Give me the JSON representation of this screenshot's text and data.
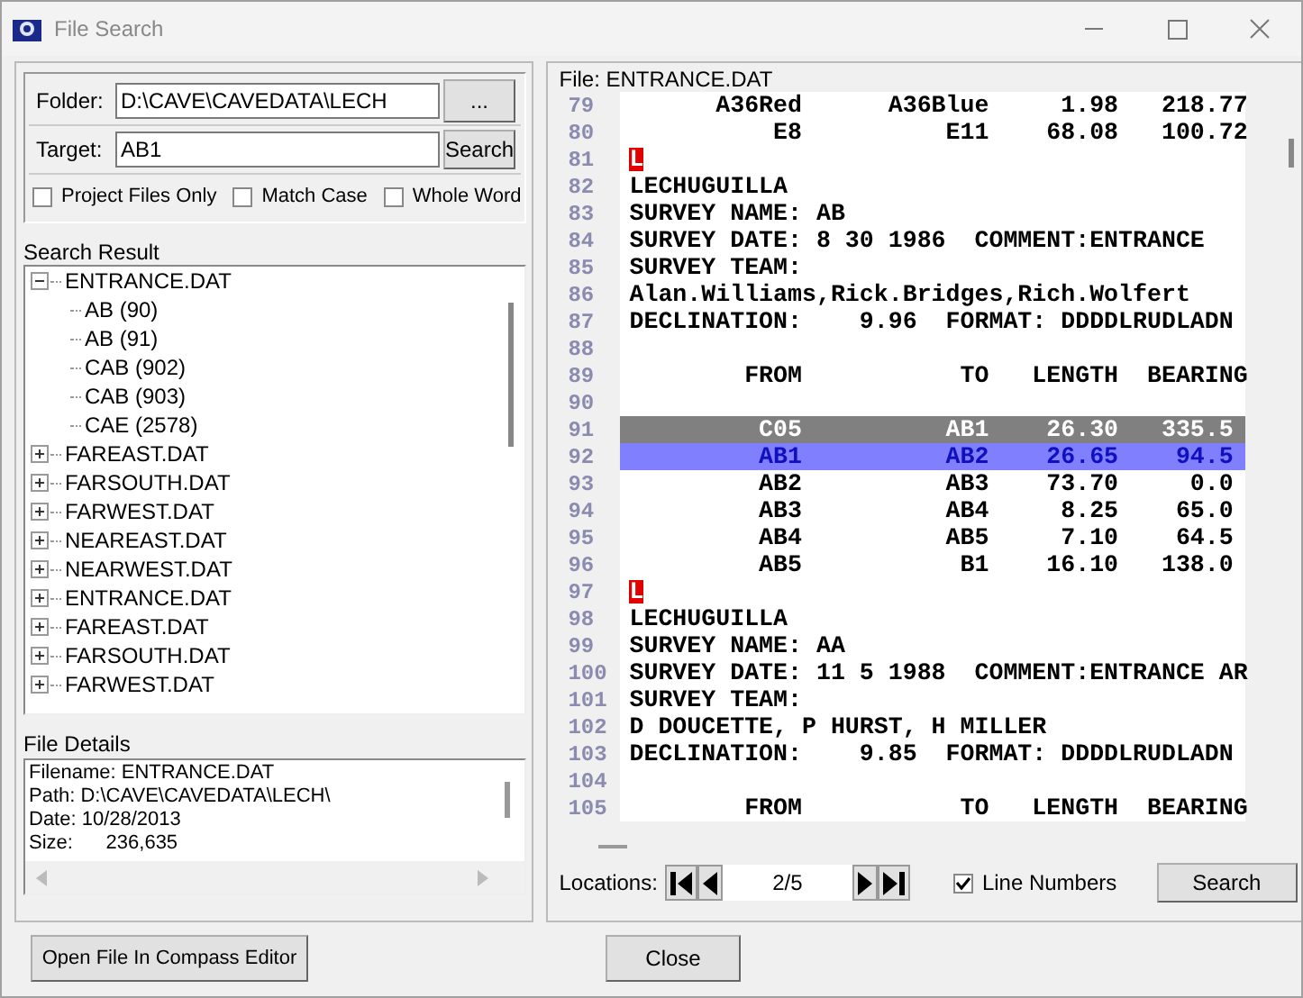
{
  "window": {
    "title": "File Search"
  },
  "search_form": {
    "folder_label": "Folder:",
    "folder_value": "D:\\CAVE\\CAVEDATA\\LECH",
    "browse_button": "...",
    "target_label": "Target:",
    "target_value": "AB1",
    "search_button": "Search",
    "options": [
      {
        "label": "Project Files Only",
        "checked": false
      },
      {
        "label": "Match Case",
        "checked": false
      },
      {
        "label": "Whole Word",
        "checked": false
      }
    ]
  },
  "search_result": {
    "label": "Search Result",
    "tree": [
      {
        "label": "ENTRANCE.DAT",
        "expanded": true,
        "children": [
          {
            "label": "AB (90)"
          },
          {
            "label": "AB (91)"
          },
          {
            "label": "CAB (902)"
          },
          {
            "label": "CAB (903)"
          },
          {
            "label": "CAE (2578)"
          }
        ]
      },
      {
        "label": "FAREAST.DAT",
        "expanded": false
      },
      {
        "label": "FARSOUTH.DAT",
        "expanded": false
      },
      {
        "label": "FARWEST.DAT",
        "expanded": false
      },
      {
        "label": "NEAREAST.DAT",
        "expanded": false
      },
      {
        "label": "NEARWEST.DAT",
        "expanded": false
      },
      {
        "label": "ENTRANCE.DAT",
        "expanded": false
      },
      {
        "label": "FAREAST.DAT",
        "expanded": false
      },
      {
        "label": "FARSOUTH.DAT",
        "expanded": false
      },
      {
        "label": "FARWEST.DAT",
        "expanded": false
      }
    ]
  },
  "file_details": {
    "label": "File Details",
    "lines": [
      "Filename: ENTRANCE.DAT",
      "Path: D:\\CAVE\\CAVEDATA\\LECH\\",
      "Date: 10/28/2013",
      "Size:      236,635"
    ]
  },
  "viewer": {
    "file_label": "File: ENTRANCE.DAT",
    "lines": [
      {
        "number": "79",
        "kind": "text",
        "text": "      A36Red      A36Blue     1.98   218.77"
      },
      {
        "number": "80",
        "kind": "text",
        "text": "          E8          E11    68.08   100.72"
      },
      {
        "number": "81",
        "kind": "marker",
        "text": "L"
      },
      {
        "number": "82",
        "kind": "text",
        "text": "LECHUGUILLA"
      },
      {
        "number": "83",
        "kind": "text",
        "text": "SURVEY NAME: AB"
      },
      {
        "number": "84",
        "kind": "text",
        "text": "SURVEY DATE: 8 30 1986  COMMENT:ENTRANCE"
      },
      {
        "number": "85",
        "kind": "text",
        "text": "SURVEY TEAM:"
      },
      {
        "number": "86",
        "kind": "text",
        "text": "Alan.Williams,Rick.Bridges,Rich.Wolfert"
      },
      {
        "number": "87",
        "kind": "text",
        "text": "DECLINATION:    9.96  FORMAT: DDDDLRUDLADN"
      },
      {
        "number": "88",
        "kind": "blank"
      },
      {
        "number": "89",
        "kind": "text",
        "text": "        FROM           TO   LENGTH  BEARING"
      },
      {
        "number": "90",
        "kind": "blank"
      },
      {
        "number": "91",
        "kind": "current",
        "text": "         C05          AB1    26.30   335.5"
      },
      {
        "number": "92",
        "kind": "match",
        "text": "         AB1          AB2    26.65    94.5"
      },
      {
        "number": "93",
        "kind": "text",
        "text": "         AB2          AB3    73.70     0.0"
      },
      {
        "number": "94",
        "kind": "text",
        "text": "         AB3          AB4     8.25    65.0"
      },
      {
        "number": "95",
        "kind": "text",
        "text": "         AB4          AB5     7.10    64.5"
      },
      {
        "number": "96",
        "kind": "text",
        "text": "         AB5           B1    16.10   138.0"
      },
      {
        "number": "97",
        "kind": "marker",
        "text": "L"
      },
      {
        "number": "98",
        "kind": "text",
        "text": "LECHUGUILLA"
      },
      {
        "number": "99",
        "kind": "text",
        "text": "SURVEY NAME: AA"
      },
      {
        "number": "100",
        "kind": "text",
        "text": "SURVEY DATE: 11 5 1988  COMMENT:ENTRANCE AR"
      },
      {
        "number": "101",
        "kind": "text",
        "text": "SURVEY TEAM:"
      },
      {
        "number": "102",
        "kind": "text",
        "text": "D DOUCETTE, P HURST, H MILLER"
      },
      {
        "number": "103",
        "kind": "text",
        "text": "DECLINATION:    9.85  FORMAT: DDDDLRUDLADN"
      },
      {
        "number": "104",
        "kind": "blank"
      },
      {
        "number": "105",
        "kind": "text",
        "text": "        FROM           TO   LENGTH  BEARING"
      }
    ],
    "locations_label": "Locations:",
    "position": "2/5",
    "line_numbers": {
      "label": "Line Numbers",
      "checked": true
    },
    "search_button": "Search"
  },
  "buttons": [
    "Open File In Compass Editor",
    "Close"
  ]
}
